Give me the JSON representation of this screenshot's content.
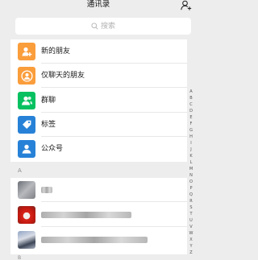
{
  "header": {
    "title": "通讯录",
    "add_icon": "add-contact-icon"
  },
  "search": {
    "placeholder": "搜索",
    "icon": "search-icon"
  },
  "functions": [
    {
      "label": "新的朋友",
      "icon": "new-friend-icon",
      "color": "#fa9d3b"
    },
    {
      "label": "仅聊天的朋友",
      "icon": "chat-only-friends-icon",
      "color": "#fa9d3b"
    },
    {
      "label": "群聊",
      "icon": "group-chat-icon",
      "color": "#07c160"
    },
    {
      "label": "标签",
      "icon": "tag-icon",
      "color": "#2782d7"
    },
    {
      "label": "公众号",
      "icon": "official-account-icon",
      "color": "#2782d7"
    }
  ],
  "sections": [
    {
      "letter": "A"
    },
    {
      "letter": "B"
    }
  ],
  "index_letters": [
    "🔍",
    "↑",
    "A",
    "B",
    "C",
    "D",
    "E",
    "F",
    "G",
    "H",
    "I",
    "J",
    "K",
    "L",
    "M",
    "N",
    "O",
    "P",
    "Q",
    "R",
    "S",
    "T",
    "U",
    "V",
    "W",
    "X",
    "Y",
    "Z",
    "#"
  ]
}
